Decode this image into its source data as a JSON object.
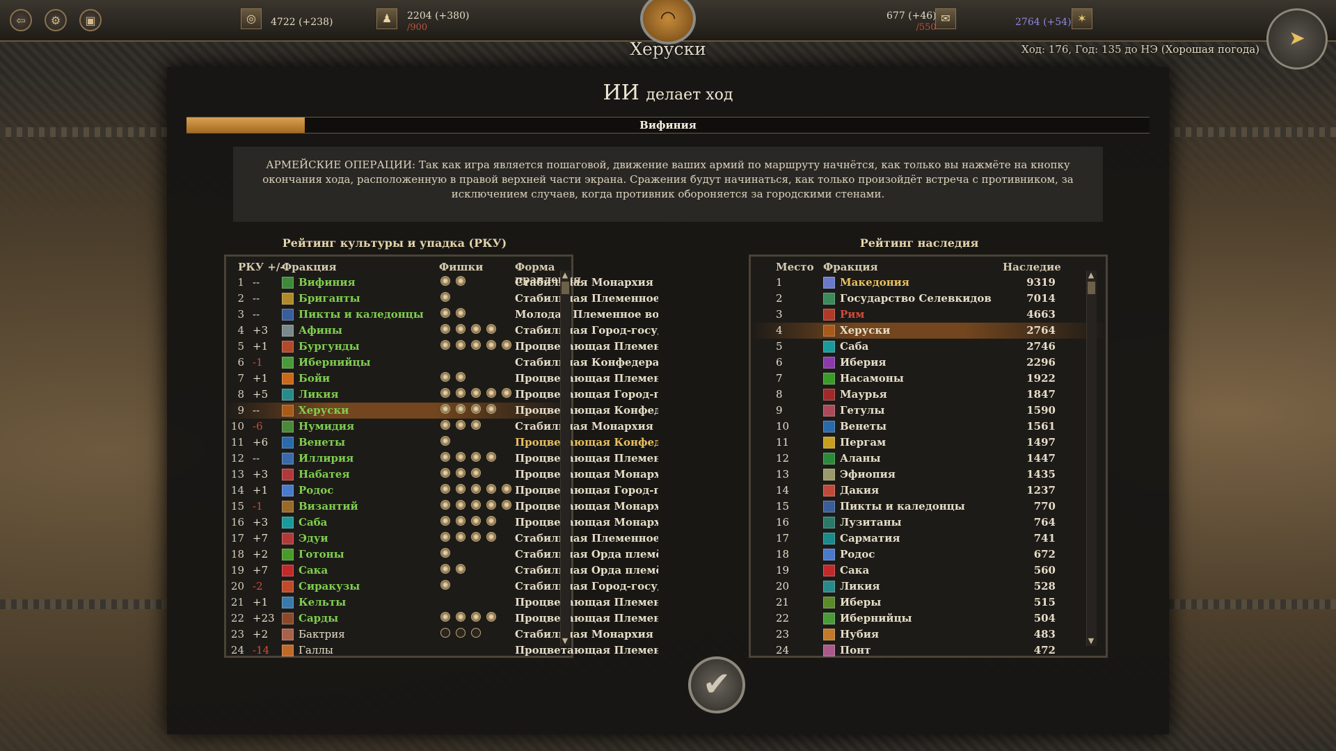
{
  "topbar": {
    "gold": "4722 (+238)",
    "population": "2204 (+380)",
    "population_cap": "/900",
    "food": "677 (+46)",
    "food_cap": "/550",
    "legacy": "2764 (+54)",
    "faction_name": "Херуски",
    "turn_info": "Ход: 176, Год: 135 до НЭ (Хорошая погода)"
  },
  "panel": {
    "title_big": "ИИ",
    "title_small": "делает  ход",
    "progress_label": "Вифиния",
    "progress_fraction": 0.123,
    "tip": "АРМЕЙСКИЕ ОПЕРАЦИИ: Так как игра является пошаговой, движение ваших армий по маршруту начнётся, как только вы нажмёте на кнопку окончания хода, расположенную в правой верхней части экрана. Сражения будут начинаться, как только произойдёт встреча с противником, за исключением случаев, когда противник обороняется за городскими стенами."
  },
  "left_table": {
    "title": "Рейтинг культуры и упадка (РКУ)",
    "headers": {
      "rank": "РКУ +/-",
      "faction": "Фракция",
      "chips": "Фишки",
      "gov": "Форма правления"
    },
    "rows": [
      {
        "rank": "1",
        "delta": "--",
        "name": "Вифиния",
        "chips": 2,
        "empty": 0,
        "gov": "Стабильная Монархия",
        "icon": "#3f8a3a",
        "style": "green",
        "gov_style": "white"
      },
      {
        "rank": "2",
        "delta": "--",
        "name": "Бриганты",
        "chips": 1,
        "empty": 0,
        "gov": "Стабильная Племенное в",
        "icon": "#b08a2a",
        "style": "green",
        "gov_style": "white"
      },
      {
        "rank": "3",
        "delta": "--",
        "name": "Пикты и каледонцы",
        "chips": 2,
        "empty": 0,
        "gov": "Молодая Племенное вож",
        "icon": "#3a5e9a",
        "style": "green",
        "gov_style": "white"
      },
      {
        "rank": "4",
        "delta": "+3",
        "name": "Афины",
        "chips": 4,
        "empty": 0,
        "gov": "Стабильная Город-госуда",
        "icon": "#7a8a8a",
        "style": "green",
        "gov_style": "white"
      },
      {
        "rank": "5",
        "delta": "+1",
        "name": "Бургунды",
        "chips": 5,
        "empty": 0,
        "gov": "Процветающая Племенн",
        "icon": "#b04a2a",
        "style": "green",
        "gov_style": "white"
      },
      {
        "rank": "6",
        "delta": "-1",
        "name": "Ибернийцы",
        "chips": 0,
        "empty": 0,
        "gov": "Стабильная Конфедерац",
        "icon": "#4a9a3a",
        "style": "green",
        "gov_style": "white"
      },
      {
        "rank": "7",
        "delta": "+1",
        "name": "Бойи",
        "chips": 2,
        "empty": 0,
        "gov": "Процветающая Племенн",
        "icon": "#c86a1a",
        "style": "green",
        "gov_style": "white"
      },
      {
        "rank": "8",
        "delta": "+5",
        "name": "Ликия",
        "chips": 5,
        "empty": 0,
        "gov": "Процветающая Город-го",
        "icon": "#2a8a8a",
        "style": "green",
        "gov_style": "white"
      },
      {
        "rank": "9",
        "delta": "--",
        "name": "Херуски",
        "chips": 4,
        "empty": 0,
        "gov": "Процветающая Конфеде",
        "icon": "#a85a1a",
        "style": "green",
        "gov_style": "white",
        "highlight": true
      },
      {
        "rank": "10",
        "delta": "-6",
        "name": "Нумидия",
        "chips": 3,
        "empty": 0,
        "gov": "Стабильная Монархия",
        "icon": "#4a8a3a",
        "style": "green",
        "gov_style": "white"
      },
      {
        "rank": "11",
        "delta": "+6",
        "name": "Венеты",
        "chips": 1,
        "empty": 0,
        "gov": "Процветающая Конфеде",
        "icon": "#2a6aaa",
        "style": "green",
        "gov_style": "gold"
      },
      {
        "rank": "12",
        "delta": "--",
        "name": "Иллирия",
        "chips": 4,
        "empty": 0,
        "gov": "Процветающая Племенн",
        "icon": "#3a6aaa",
        "style": "green",
        "gov_style": "white"
      },
      {
        "rank": "13",
        "delta": "+3",
        "name": "Набатея",
        "chips": 3,
        "empty": 0,
        "gov": "Процветающая Монархи",
        "icon": "#b03a3a",
        "style": "green",
        "gov_style": "white"
      },
      {
        "rank": "14",
        "delta": "+1",
        "name": "Родос",
        "chips": 5,
        "empty": 0,
        "gov": "Процветающая Город-го",
        "icon": "#4a7aca",
        "style": "green",
        "gov_style": "white"
      },
      {
        "rank": "15",
        "delta": "-1",
        "name": "Византий",
        "chips": 5,
        "empty": 0,
        "gov": "Процветающая Монархи",
        "icon": "#9a6a2a",
        "style": "green",
        "gov_style": "white"
      },
      {
        "rank": "16",
        "delta": "+3",
        "name": "Саба",
        "chips": 4,
        "empty": 0,
        "gov": "Процветающая Монархи",
        "icon": "#1a9a9a",
        "style": "green",
        "gov_style": "white"
      },
      {
        "rank": "17",
        "delta": "+7",
        "name": "Эдуи",
        "chips": 4,
        "empty": 0,
        "gov": "Стабильная Племенное в",
        "icon": "#b03a3a",
        "style": "green",
        "gov_style": "white"
      },
      {
        "rank": "18",
        "delta": "+2",
        "name": "Готоны",
        "chips": 1,
        "empty": 0,
        "gov": "Стабильная Орда племён",
        "icon": "#4a9a2a",
        "style": "green",
        "gov_style": "white"
      },
      {
        "rank": "19",
        "delta": "+7",
        "name": "Сака",
        "chips": 2,
        "empty": 0,
        "gov": "Стабильная Орда племён",
        "icon": "#c02a2a",
        "style": "green",
        "gov_style": "white"
      },
      {
        "rank": "20",
        "delta": "-2",
        "name": "Сиракузы",
        "chips": 1,
        "empty": 0,
        "gov": "Стабильная Город-госуда",
        "icon": "#c04a2a",
        "style": "green",
        "gov_style": "white"
      },
      {
        "rank": "21",
        "delta": "+1",
        "name": "Кельты",
        "chips": 0,
        "empty": 0,
        "gov": "Процветающая Племенн",
        "icon": "#3a7aaa",
        "style": "green",
        "gov_style": "white"
      },
      {
        "rank": "22",
        "delta": "+23",
        "name": "Сарды",
        "chips": 4,
        "empty": 0,
        "gov": "Процветающая Племенн",
        "icon": "#8a4a2a",
        "style": "green",
        "gov_style": "white"
      },
      {
        "rank": "23",
        "delta": "+2",
        "name": "Бактрия",
        "chips": 0,
        "empty": 3,
        "gov": "Стабильная Монархия",
        "icon": "#a8624a",
        "style": "white",
        "gov_style": "white"
      },
      {
        "rank": "24",
        "delta": "-14",
        "name": "Галлы",
        "chips": 0,
        "empty": 0,
        "gov": "Процветающая Племенн",
        "icon": "#c06a2a",
        "style": "white",
        "gov_style": "white"
      }
    ]
  },
  "right_table": {
    "title": "Рейтинг наследия",
    "headers": {
      "place": "Место",
      "faction": "Фракция",
      "legacy": "Наследие"
    },
    "rows": [
      {
        "place": "1",
        "name": "Македония",
        "value": "9319",
        "icon": "#6a7aca",
        "style": "gold"
      },
      {
        "place": "2",
        "name": "Государство Селевкидов",
        "value": "7014",
        "icon": "#3a8a5a",
        "style": "white"
      },
      {
        "place": "3",
        "name": "Рим",
        "value": "4663",
        "icon": "#b03a2a",
        "style": "red"
      },
      {
        "place": "4",
        "name": "Херуски",
        "value": "2764",
        "icon": "#a85a1a",
        "style": "white",
        "highlight": true
      },
      {
        "place": "5",
        "name": "Саба",
        "value": "2746",
        "icon": "#1a9a9a",
        "style": "white"
      },
      {
        "place": "6",
        "name": "Иберия",
        "value": "2296",
        "icon": "#8a3aaa",
        "style": "white"
      },
      {
        "place": "7",
        "name": "Насамоны",
        "value": "1922",
        "icon": "#3a9a2a",
        "style": "white"
      },
      {
        "place": "8",
        "name": "Маурья",
        "value": "1847",
        "icon": "#a02a2a",
        "style": "white"
      },
      {
        "place": "9",
        "name": "Гетулы",
        "value": "1590",
        "icon": "#aa4a5a",
        "style": "white"
      },
      {
        "place": "10",
        "name": "Венеты",
        "value": "1561",
        "icon": "#2a6aaa",
        "style": "white"
      },
      {
        "place": "11",
        "name": "Пергам",
        "value": "1497",
        "icon": "#c8a020",
        "style": "white"
      },
      {
        "place": "12",
        "name": "Аланы",
        "value": "1447",
        "icon": "#2a8a3a",
        "style": "white"
      },
      {
        "place": "13",
        "name": "Эфиопия",
        "value": "1435",
        "icon": "#9a9a6a",
        "style": "white"
      },
      {
        "place": "14",
        "name": "Дакия",
        "value": "1237",
        "icon": "#c04a3a",
        "style": "white"
      },
      {
        "place": "15",
        "name": "Пикты и каледонцы",
        "value": "770",
        "icon": "#3a5e9a",
        "style": "white"
      },
      {
        "place": "16",
        "name": "Лузитаны",
        "value": "764",
        "icon": "#2a7a6a",
        "style": "white"
      },
      {
        "place": "17",
        "name": "Сарматия",
        "value": "741",
        "icon": "#1a8a8a",
        "style": "white"
      },
      {
        "place": "18",
        "name": "Родос",
        "value": "672",
        "icon": "#4a7aca",
        "style": "white"
      },
      {
        "place": "19",
        "name": "Сака",
        "value": "560",
        "icon": "#c02a2a",
        "style": "white"
      },
      {
        "place": "20",
        "name": "Ликия",
        "value": "528",
        "icon": "#2a8a8a",
        "style": "white"
      },
      {
        "place": "21",
        "name": "Иберы",
        "value": "515",
        "icon": "#5a8a2a",
        "style": "white"
      },
      {
        "place": "22",
        "name": "Ибернийцы",
        "value": "504",
        "icon": "#4a9a3a",
        "style": "white"
      },
      {
        "place": "23",
        "name": "Нубия",
        "value": "483",
        "icon": "#c07a2a",
        "style": "white"
      },
      {
        "place": "24",
        "name": "Понт",
        "value": "472",
        "icon": "#aa5a8a",
        "style": "white"
      }
    ]
  },
  "icons": {
    "back": "exit-icon",
    "settings": "gear-icon",
    "save": "save-icon",
    "confirm": "checkmark-icon"
  }
}
